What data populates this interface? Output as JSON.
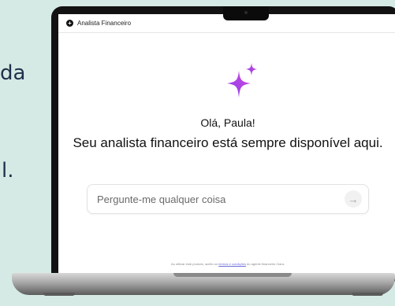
{
  "background_text": {
    "line1": "da",
    "line2": "l."
  },
  "app": {
    "title": "Analista Financeiro",
    "greeting": "Olá, Paula!",
    "headline": "Seu analista financeiro está sempre disponível aqui.",
    "input_placeholder": "Pergunte-me qualquer coisa",
    "input_value": "",
    "footer_prefix": "Ao utilizar este produto, aceito os ",
    "footer_link": "termos e condições",
    "footer_suffix": " do agente financeiro Clara."
  },
  "icons": {
    "header": "plus-circle-icon",
    "hero": "sparkle-icon",
    "send": "arrow-right-icon"
  },
  "colors": {
    "background": "#d6eae5",
    "sparkle_start": "#8a3cf0",
    "sparkle_end": "#d04ad9"
  }
}
